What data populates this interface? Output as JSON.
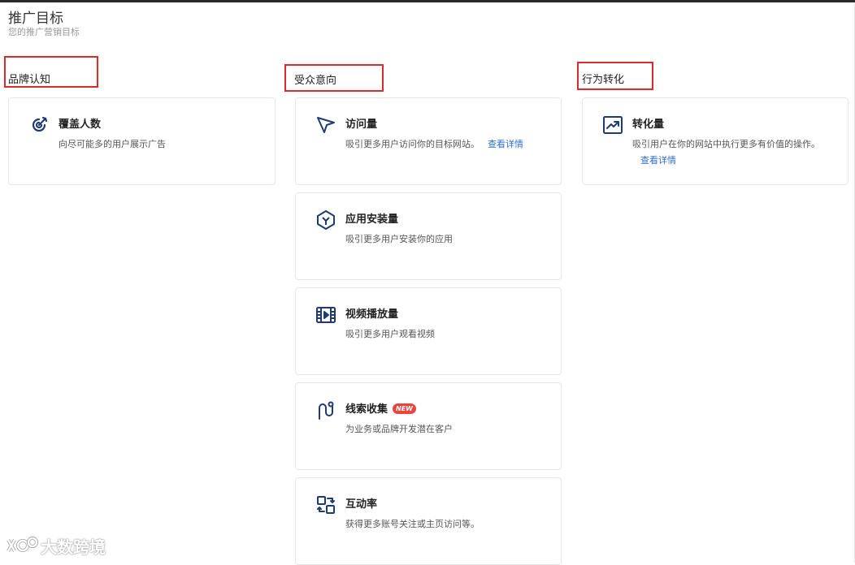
{
  "header": {
    "title": "推广目标",
    "subtitle": "您的推广营销目标"
  },
  "columns": {
    "brand": {
      "heading": "品牌认知",
      "cards": [
        {
          "title": "覆盖人数",
          "desc": "向尽可能多的用户展示广告",
          "icon": "target-reach-icon"
        }
      ]
    },
    "audience": {
      "heading": "受众意向",
      "cards": [
        {
          "title": "访问量",
          "desc": "吸引更多用户访问你的目标网站。",
          "link": "查看详情",
          "icon": "cursor-arrow-icon"
        },
        {
          "title": "应用安装量",
          "desc": "吸引更多用户安装你的应用",
          "icon": "app-cube-icon"
        },
        {
          "title": "视频播放量",
          "desc": "吸引更多用户观看视频",
          "icon": "video-film-icon"
        },
        {
          "title": "线索收集",
          "badge": "NEW",
          "desc": "为业务或品牌开发潜在客户",
          "icon": "lead-path-icon"
        },
        {
          "title": "互动率",
          "desc": "获得更多账号关注或主页访问等。",
          "icon": "interaction-swap-icon"
        }
      ]
    },
    "conversion": {
      "heading": "行为转化",
      "cards": [
        {
          "title": "转化量",
          "desc": "吸引用户在你的网站中执行更多有价值的操作。",
          "link": "查看详情",
          "icon": "trend-chart-icon"
        }
      ]
    }
  },
  "watermark": {
    "text": "大数跨境",
    "logo_icon": "brand-logo-icon"
  },
  "colors": {
    "accent": "#1f3b73",
    "link": "#2f6fd6",
    "highlight_box": "#e02a2a",
    "badge": "#e8453c"
  }
}
